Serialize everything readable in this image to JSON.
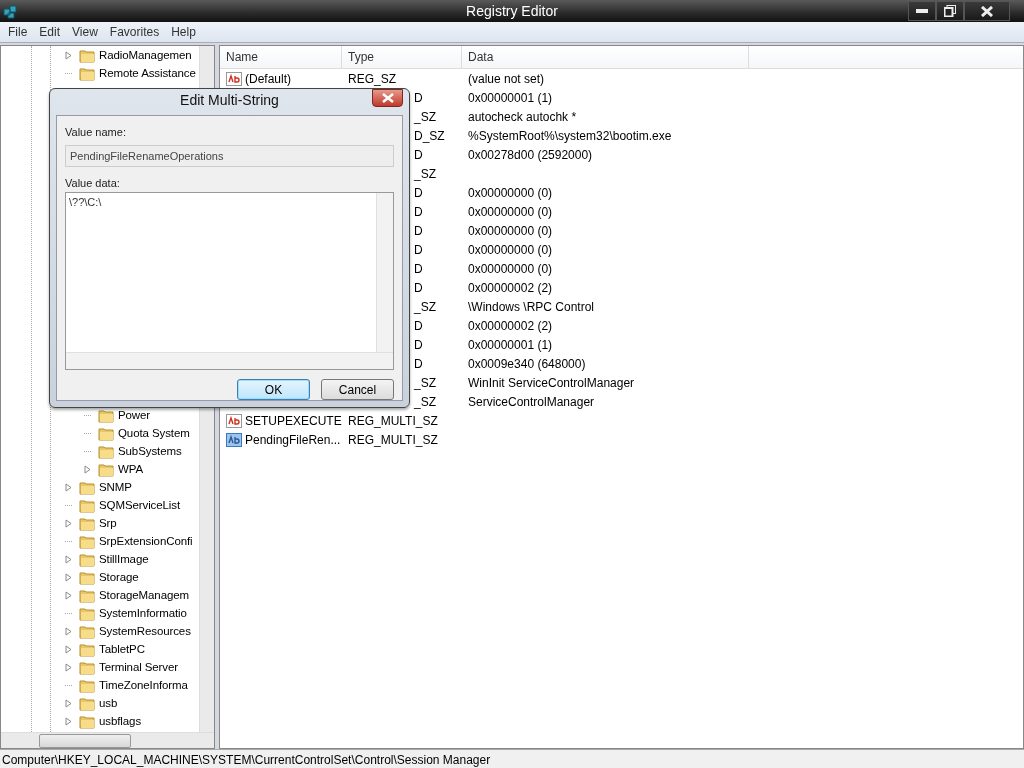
{
  "window": {
    "title": "Registry Editor"
  },
  "menu": [
    "File",
    "Edit",
    "View",
    "Favorites",
    "Help"
  ],
  "tree": {
    "items": [
      {
        "label": "RadioManagemen",
        "expandable": true
      },
      {
        "label": "Remote Assistance",
        "expandable": false
      },
      {
        "children": [
          {
            "label": "Power",
            "expandable": false
          },
          {
            "label": "Quota System",
            "expandable": false
          },
          {
            "label": "SubSystems",
            "expandable": false
          },
          {
            "label": "WPA",
            "expandable": true
          }
        ]
      },
      {
        "label": "SNMP",
        "expandable": true
      },
      {
        "label": "SQMServiceList",
        "expandable": false
      },
      {
        "label": "Srp",
        "expandable": true
      },
      {
        "label": "SrpExtensionConfi",
        "expandable": false
      },
      {
        "label": "StillImage",
        "expandable": true
      },
      {
        "label": "Storage",
        "expandable": true
      },
      {
        "label": "StorageManagem",
        "expandable": true
      },
      {
        "label": "SystemInformatio",
        "expandable": false
      },
      {
        "label": "SystemResources",
        "expandable": true
      },
      {
        "label": "TabletPC",
        "expandable": true
      },
      {
        "label": "Terminal Server",
        "expandable": true
      },
      {
        "label": "TimeZoneInforma",
        "expandable": false
      },
      {
        "label": "usb",
        "expandable": true
      },
      {
        "label": "usbflags",
        "expandable": true
      }
    ]
  },
  "table": {
    "columns": [
      "Name",
      "Type",
      "Data"
    ],
    "rows": [
      {
        "name": "(Default)",
        "type": "REG_SZ",
        "data": "(value not set)",
        "selected": false
      },
      {
        "type": "D",
        "data": "0x00000001 (1)"
      },
      {
        "type": "_SZ",
        "data": "autocheck autochk *"
      },
      {
        "type": "D_SZ",
        "data": "%SystemRoot%\\system32\\bootim.exe"
      },
      {
        "type": "D",
        "data": "0x00278d00 (2592000)"
      },
      {
        "type": "_SZ"
      },
      {
        "type": "D",
        "data": "0x00000000 (0)"
      },
      {
        "type": "D",
        "data": "0x00000000 (0)"
      },
      {
        "type": "D",
        "data": "0x00000000 (0)"
      },
      {
        "type": "D",
        "data": "0x00000000 (0)"
      },
      {
        "type": "D",
        "data": "0x00000000 (0)"
      },
      {
        "type": "D",
        "data": "0x00000002 (2)"
      },
      {
        "type": "_SZ",
        "data": "\\Windows \\RPC Control"
      },
      {
        "type": "D",
        "data": "0x00000002 (2)"
      },
      {
        "type": "D",
        "data": "0x00000001 (1)"
      },
      {
        "type": "D",
        "data": "0x0009e340 (648000)"
      },
      {
        "type": "_SZ",
        "data": "WinInit ServiceControlManager"
      },
      {
        "type": "_SZ",
        "data": "ServiceControlManager"
      },
      {
        "name": "SETUPEXECUTE",
        "type": "REG_MULTI_SZ",
        "selected": false
      },
      {
        "name": "PendingFileRen...",
        "type": "REG_MULTI_SZ",
        "selected": true
      }
    ]
  },
  "status_bar": "Computer\\HKEY_LOCAL_MACHINE\\SYSTEM\\CurrentControlSet\\Control\\Session Manager",
  "dialog": {
    "title": "Edit Multi-String",
    "value_name_label": "Value name:",
    "value_name": "PendingFileRenameOperations",
    "value_data_label": "Value data:",
    "value_data": "\\??\\C:\\",
    "buttons": [
      {
        "label": "OK",
        "focused": true
      },
      {
        "label": "Cancel",
        "focused": false
      }
    ]
  }
}
